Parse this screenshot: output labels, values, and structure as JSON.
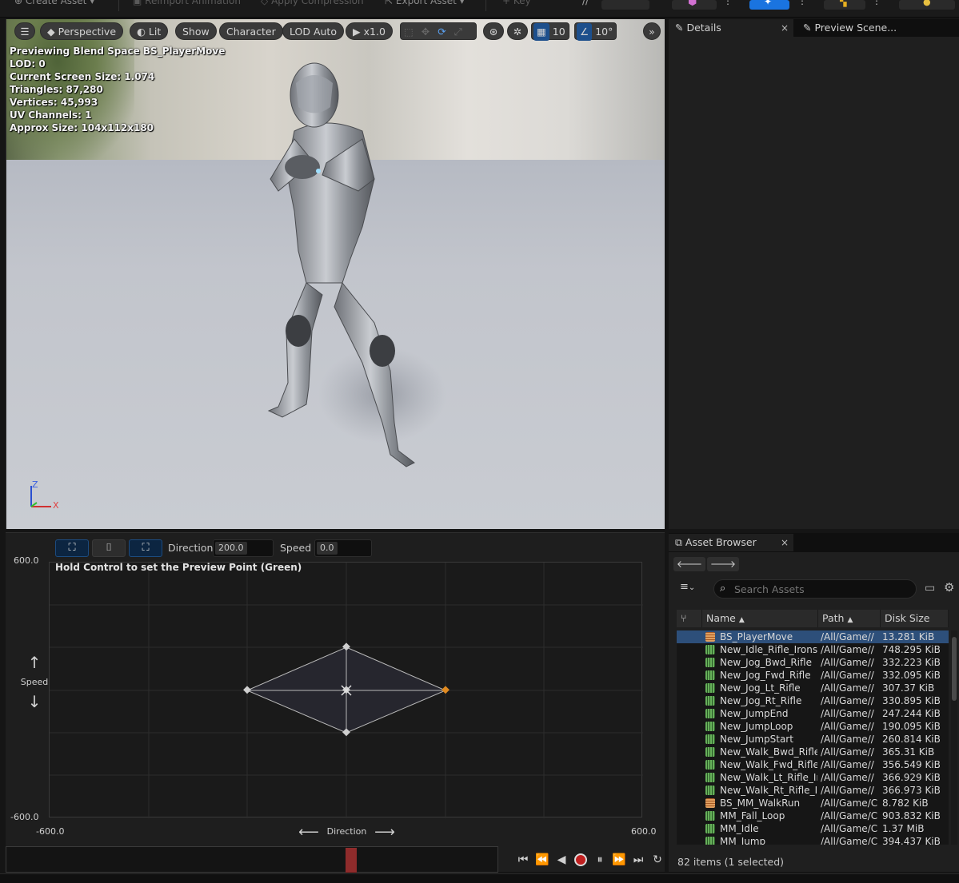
{
  "toolbar": {
    "create_asset": "Create Asset",
    "reimport": "Reimport Animation",
    "apply_compression": "Apply Compression",
    "export_asset": "Export Asset",
    "key": "Key"
  },
  "viewport": {
    "perspective": "Perspective",
    "lit": "Lit",
    "show": "Show",
    "character": "Character",
    "lod": "LOD Auto",
    "play_rate": "x1.0",
    "grid_snap": "10",
    "rot_snap": "10°",
    "stats": [
      "Previewing Blend Space BS_PlayerMove",
      "LOD: 0",
      "Current Screen Size: 1.074",
      "Triangles: 87,280",
      "Vertices: 45,993",
      "UV Channels: 1",
      "Approx Size: 104x112x180"
    ],
    "axis_z": "Z",
    "axis_x": "X"
  },
  "blendspace": {
    "direction_label": "Direction",
    "direction_value": "200.0",
    "speed_label": "Speed",
    "speed_value": "0.0",
    "hint": "Hold Control to set the Preview Point (Green)",
    "y_max": "600.0",
    "y_min": "-600.0",
    "x_min": "-600.0",
    "x_max": "600.0",
    "y_axis_label": "Speed",
    "x_axis_label": "Direction"
  },
  "details": {
    "tab_details": "Details",
    "tab_preview": "Preview Scene..."
  },
  "asset_browser": {
    "tab": "Asset Browser",
    "search_placeholder": "Search Assets",
    "col_name": "Name",
    "col_path": "Path",
    "col_size": "Disk Size",
    "status": "82 items (1 selected)",
    "rows": [
      {
        "name": "BS_PlayerMove",
        "path": "/All/Game//",
        "size": "13.281 KiB",
        "kind": "blendspace",
        "selected": true
      },
      {
        "name": "New_Idle_Rifle_Irons",
        "path": "/All/Game//",
        "size": "748.295 KiB",
        "kind": "anim"
      },
      {
        "name": "New_Jog_Bwd_Rifle",
        "path": "/All/Game//",
        "size": "332.223 KiB",
        "kind": "anim"
      },
      {
        "name": "New_Jog_Fwd_Rifle",
        "path": "/All/Game//",
        "size": "332.095 KiB",
        "kind": "anim"
      },
      {
        "name": "New_Jog_Lt_Rifle",
        "path": "/All/Game//",
        "size": "307.37 KiB",
        "kind": "anim"
      },
      {
        "name": "New_Jog_Rt_Rifle",
        "path": "/All/Game//",
        "size": "330.895 KiB",
        "kind": "anim"
      },
      {
        "name": "New_JumpEnd",
        "path": "/All/Game//",
        "size": "247.244 KiB",
        "kind": "anim"
      },
      {
        "name": "New_JumpLoop",
        "path": "/All/Game//",
        "size": "190.095 KiB",
        "kind": "anim"
      },
      {
        "name": "New_JumpStart",
        "path": "/All/Game//",
        "size": "260.814 KiB",
        "kind": "anim"
      },
      {
        "name": "New_Walk_Bwd_Rifle",
        "path": "/All/Game//",
        "size": "365.31 KiB",
        "kind": "anim"
      },
      {
        "name": "New_Walk_Fwd_Rifle",
        "path": "/All/Game//",
        "size": "356.549 KiB",
        "kind": "anim"
      },
      {
        "name": "New_Walk_Lt_Rifle_Ir",
        "path": "/All/Game//",
        "size": "366.929 KiB",
        "kind": "anim"
      },
      {
        "name": "New_Walk_Rt_Rifle_Ir",
        "path": "/All/Game//",
        "size": "366.973 KiB",
        "kind": "anim"
      },
      {
        "name": "BS_MM_WalkRun",
        "path": "/All/Game/C",
        "size": "8.782 KiB",
        "kind": "blendspace"
      },
      {
        "name": "MM_Fall_Loop",
        "path": "/All/Game/C",
        "size": "903.832 KiB",
        "kind": "anim"
      },
      {
        "name": "MM_Idle",
        "path": "/All/Game/C",
        "size": "1.37 MiB",
        "kind": "anim"
      },
      {
        "name": "MM_Jump",
        "path": "/All/Game/C",
        "size": "394.437 KiB",
        "kind": "anim"
      }
    ]
  },
  "colors": {
    "accent_blue": "#1d4f8c",
    "selection": "#2d4f7a",
    "playhead": "#8f2b2b",
    "sample_orange": "#e08a20"
  }
}
